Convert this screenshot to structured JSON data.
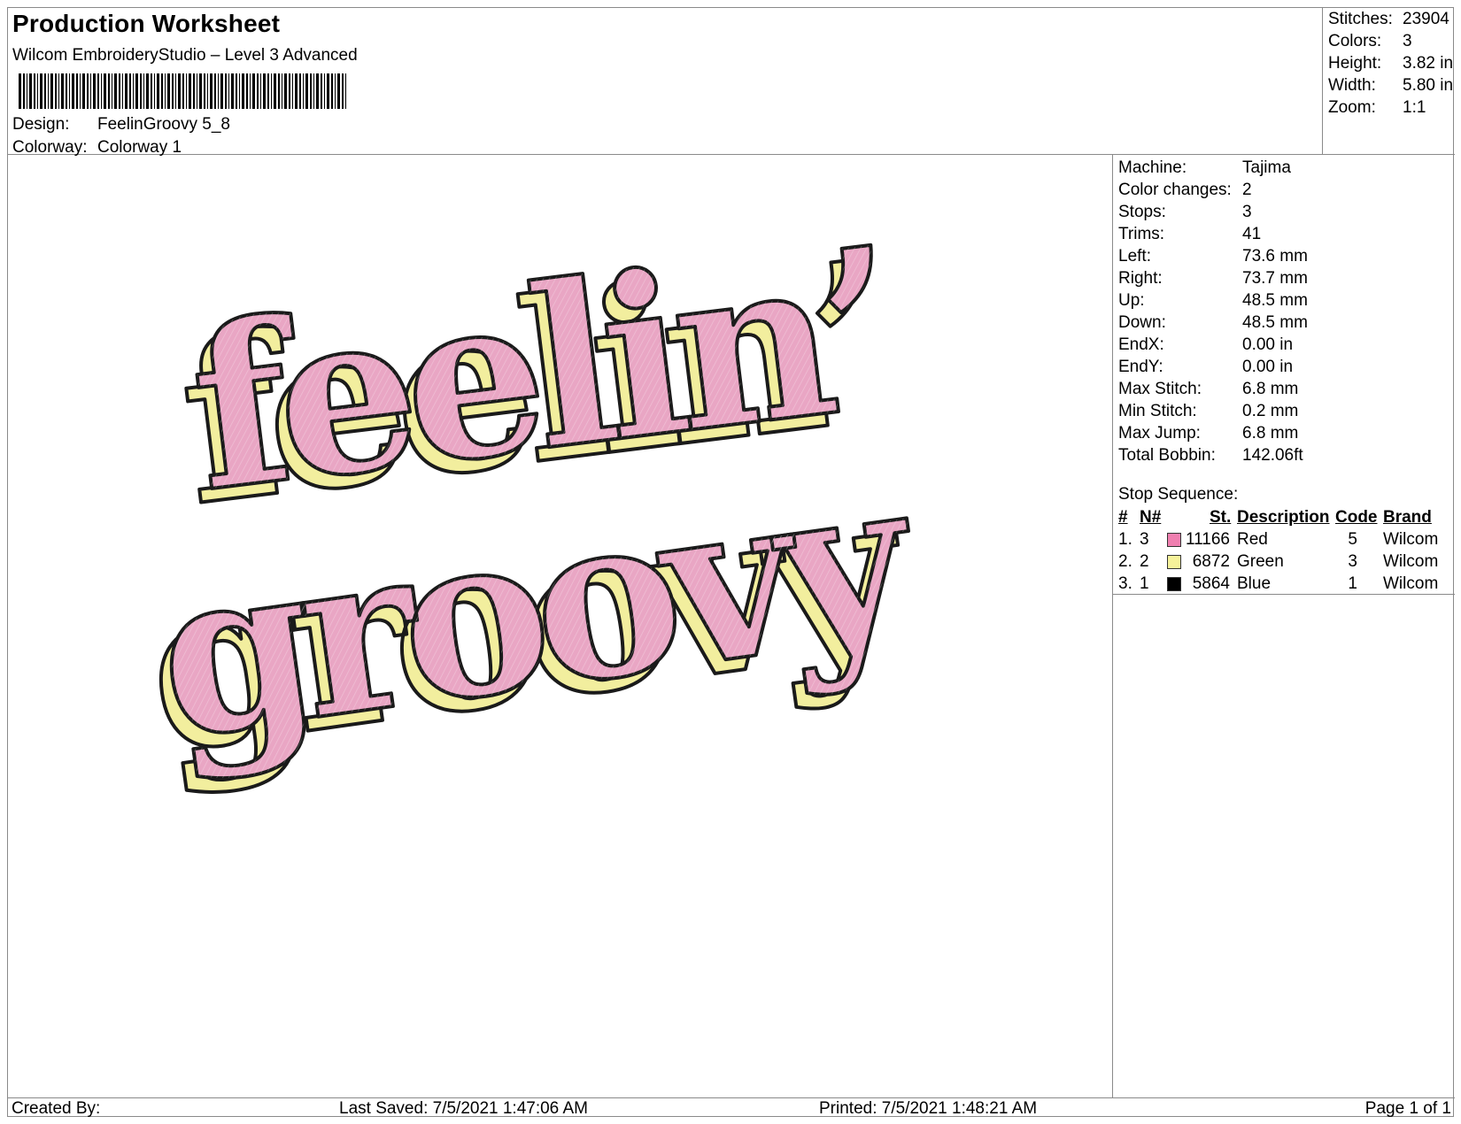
{
  "header": {
    "title": "Production Worksheet",
    "software": "Wilcom EmbroideryStudio – Level 3 Advanced",
    "design_label": "Design:",
    "design_value": "FeelinGroovy 5_8",
    "colorway_label": "Colorway:",
    "colorway_value": "Colorway 1"
  },
  "summary": {
    "stitches_label": "Stitches:",
    "stitches_value": "23904",
    "colors_label": "Colors:",
    "colors_value": "3",
    "height_label": "Height:",
    "height_value": "3.82 in",
    "width_label": "Width:",
    "width_value": "5.80 in",
    "zoom_label": "Zoom:",
    "zoom_value": "1:1"
  },
  "design_preview": {
    "line1": "feelin’",
    "line2": "groovy",
    "fill_color": "#e9a6c4",
    "shadow_color": "#f2ee9e",
    "outline_color": "#1a1a1a"
  },
  "machine_info": [
    {
      "label": "Machine:",
      "value": "Tajima"
    },
    {
      "label": "Color changes:",
      "value": "2"
    },
    {
      "label": "Stops:",
      "value": "3"
    },
    {
      "label": "Trims:",
      "value": "41"
    },
    {
      "label": "Left:",
      "value": "73.6 mm"
    },
    {
      "label": "Right:",
      "value": "73.7 mm"
    },
    {
      "label": "Up:",
      "value": "48.5 mm"
    },
    {
      "label": "Down:",
      "value": "48.5 mm"
    },
    {
      "label": "EndX:",
      "value": "0.00 in"
    },
    {
      "label": "EndY:",
      "value": "0.00 in"
    },
    {
      "label": "Max Stitch:",
      "value": "6.8 mm"
    },
    {
      "label": "Min Stitch:",
      "value": "0.2 mm"
    },
    {
      "label": "Max Jump:",
      "value": "6.8 mm"
    },
    {
      "label": "Total Bobbin:",
      "value": "142.06ft"
    }
  ],
  "stop_sequence": {
    "title": "Stop Sequence:",
    "headers": {
      "num": "#",
      "needle": "N#",
      "stitches": "St.",
      "description": "Description",
      "code": "Code",
      "brand": "Brand"
    },
    "rows": [
      {
        "num": "1.",
        "needle": "3",
        "color": "#f07fb0",
        "stitches": "11166",
        "description": "Red",
        "code": "5",
        "brand": "Wilcom"
      },
      {
        "num": "2.",
        "needle": "2",
        "color": "#f6f29a",
        "stitches": "6872",
        "description": "Green",
        "code": "3",
        "brand": "Wilcom"
      },
      {
        "num": "3.",
        "needle": "1",
        "color": "#000000",
        "stitches": "5864",
        "description": "Blue",
        "code": "1",
        "brand": "Wilcom"
      }
    ]
  },
  "footer": {
    "created_by": "Created By:",
    "last_saved": "Last Saved: 7/5/2021 1:47:06 AM",
    "printed": "Printed: 7/5/2021 1:48:21 AM",
    "page": "Page 1 of 1"
  }
}
